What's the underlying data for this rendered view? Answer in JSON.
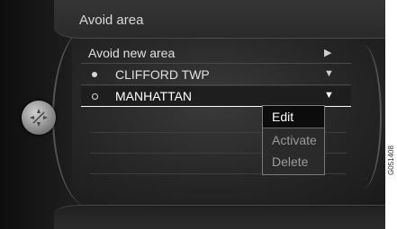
{
  "header": {
    "title": "Avoid area"
  },
  "list": {
    "items": [
      {
        "label": "Avoid new area",
        "indicator": "arrow-right"
      },
      {
        "label": "CLIFFORD TWP",
        "indicator": "arrow-down",
        "bullet": "filled"
      },
      {
        "label": "MANHATTAN",
        "indicator": "arrow-down",
        "bullet": "hollow",
        "selected": true
      }
    ]
  },
  "context_menu": {
    "items": [
      {
        "label": "Edit",
        "active": true
      },
      {
        "label": "Activate",
        "active": false
      },
      {
        "label": "Delete",
        "active": false
      }
    ]
  },
  "image_code": "G051408",
  "colors": {
    "background": "#1c1c1c",
    "text": "#e0e0e0",
    "selected_outline": "#ffffff",
    "menu_dim_text": "#9c9c9c"
  }
}
